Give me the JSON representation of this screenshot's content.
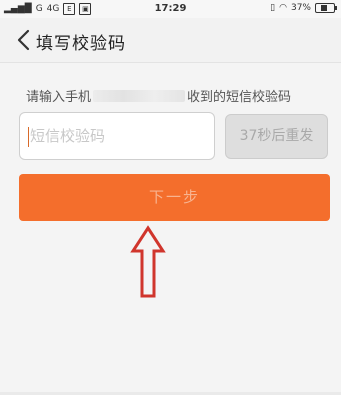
{
  "status_bar": {
    "signal": "G",
    "network": "4G",
    "app_icons": [
      "E",
      "▣"
    ],
    "time": "17:29",
    "battery_text": "37%",
    "battery_level": 0.37
  },
  "header": {
    "title": "填写校验码"
  },
  "main": {
    "hint_prefix": "请输入手机",
    "hint_suffix": "收到的短信校验码",
    "code_placeholder": "短信校验码",
    "code_value": "",
    "resend_label": "37秒后重发",
    "next_label": "下一步"
  },
  "colors": {
    "accent": "#f46e2c",
    "annotation_arrow": "#d0352c"
  }
}
